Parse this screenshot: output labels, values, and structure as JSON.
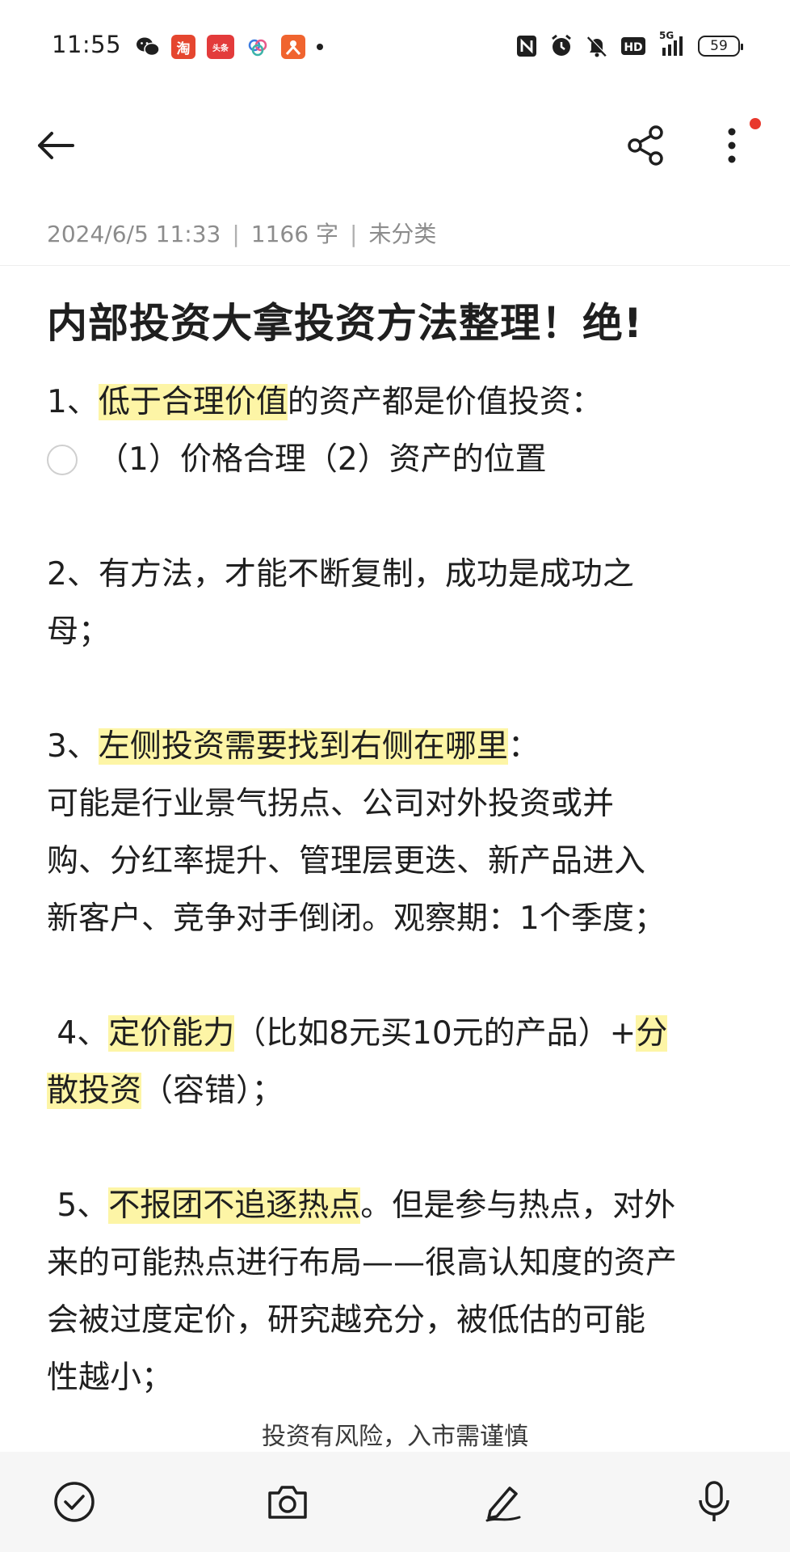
{
  "status_bar": {
    "time": "11:55",
    "notif_taobao": "淘",
    "notif_toutiao": "头条",
    "battery_level": "59",
    "network_label": "5G"
  },
  "app_bar": {
    "back_icon": "arrow-left-icon",
    "share_icon": "share-icon",
    "more_icon": "more-vertical-icon",
    "notification_dot_color": "#e8372c"
  },
  "note": {
    "date": "2024/6/5 11:33",
    "word_count": "1166 字",
    "category": "未分类",
    "separator": "|",
    "title": "内部投资大拿投资方法整理！绝!",
    "p1": {
      "prefix": "1、",
      "highlight": "低于合理价值",
      "suffix": "的资产都是价值投资："
    },
    "todo1": "（1）价格合理（2）资产的位置",
    "p2_line1": "2、有方法，才能不断复制，成功是成功之",
    "p2_line2": "母；",
    "p3": {
      "prefix": "3、",
      "highlight": "左侧投资需要找到右侧在哪里",
      "suffix": "："
    },
    "p3_line2": "可能是行业景气拐点、公司对外投资或并",
    "p3_line3": "购、分红率提升、管理层更迭、新产品进入",
    "p3_line4": "新客户、竞争对手倒闭。观察期：1个季度；",
    "p4": {
      "prefix": " 4、",
      "highlight1": "定价能力",
      "middle": "（比如8元买10元的产品）+",
      "highlight2a": "分",
      "highlight2b": "散投资",
      "suffix": "（容错）；"
    },
    "p5": {
      "prefix": " 5、",
      "highlight": "不报团不追逐热点",
      "suffix": "。但是参与热点，对外"
    },
    "p5_line2": "来的可能热点进行布局——很高认知度的资产",
    "p5_line3": "会被过度定价，研究越充分，被低估的可能",
    "p5_line4": "性越小；",
    "highlight_color": "#fdf5a6"
  },
  "disclaimer": "投资有风险，入市需谨慎",
  "bottom_bar": {
    "checklist_icon": "check-circle-icon",
    "camera_icon": "camera-icon",
    "pen_icon": "pen-icon",
    "mic_icon": "microphone-icon"
  }
}
